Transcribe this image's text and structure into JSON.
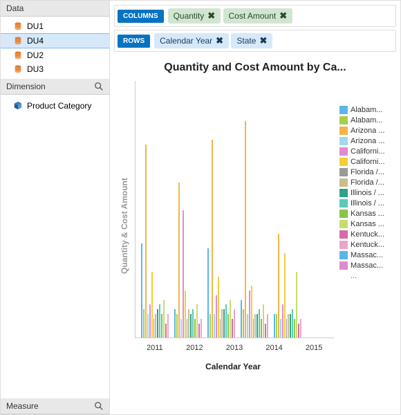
{
  "sidebar": {
    "data_header": "Data",
    "data_items": [
      {
        "label": "DU1",
        "selected": false
      },
      {
        "label": "DU4",
        "selected": true
      },
      {
        "label": "DU2",
        "selected": false
      },
      {
        "label": "DU3",
        "selected": false
      }
    ],
    "dimension_header": "Dimension",
    "dimension_items": [
      {
        "label": "Product Category"
      }
    ],
    "measure_header": "Measure"
  },
  "shelves": {
    "columns_label": "COLUMNS",
    "columns_pills": [
      {
        "label": "Quantity",
        "kind": "measure"
      },
      {
        "label": "Cost Amount",
        "kind": "measure"
      }
    ],
    "rows_label": "ROWS",
    "rows_pills": [
      {
        "label": "Calendar Year",
        "kind": "dim"
      },
      {
        "label": "State",
        "kind": "dim"
      }
    ]
  },
  "chart": {
    "title": "Quantity and Cost Amount by Ca...",
    "xlabel": "Calendar Year",
    "ylabel": "Quantity & Cost Amount",
    "legend_colors": {
      "c0": "#5bb5e8",
      "c1": "#a8cf4c",
      "c2": "#f2b54a",
      "c3": "#a1d7f2",
      "c4": "#e08bd0",
      "c5": "#f2cf3a",
      "c6": "#9a9a9a",
      "c7": "#c9bd8e",
      "c8": "#2fa08a",
      "c9": "#5cc9b8",
      "c10": "#88c44a",
      "c11": "#c5dd6a",
      "c12": "#d86aa8",
      "c13": "#e8a6cc"
    },
    "legend": [
      {
        "label": "Alabam...",
        "color": "c0"
      },
      {
        "label": "Alabam...",
        "color": "c1"
      },
      {
        "label": "Arizona ...",
        "color": "c2"
      },
      {
        "label": "Arizona ...",
        "color": "c3"
      },
      {
        "label": "Californi...",
        "color": "c4"
      },
      {
        "label": "Californi...",
        "color": "c5"
      },
      {
        "label": "Florida /...",
        "color": "c6"
      },
      {
        "label": "Florida /...",
        "color": "c7"
      },
      {
        "label": "Illinois / ...",
        "color": "c8"
      },
      {
        "label": "Illinois / ...",
        "color": "c9"
      },
      {
        "label": "Kansas ...",
        "color": "c10"
      },
      {
        "label": "Kansas ...",
        "color": "c11"
      },
      {
        "label": "Kentuck...",
        "color": "c12"
      },
      {
        "label": "Kentuck...",
        "color": "c13"
      },
      {
        "label": "Massac...",
        "color": "c0"
      },
      {
        "label": "Massac...",
        "color": "c4"
      }
    ],
    "legend_more": "..."
  },
  "chart_data": {
    "type": "bar",
    "title": "Quantity and Cost Amount by Calendar Year and State",
    "xlabel": "Calendar Year",
    "ylabel": "Quantity & Cost Amount",
    "ylim": [
      0,
      100
    ],
    "categories": [
      "2011",
      "2012",
      "2013",
      "2014",
      "2015"
    ],
    "series_per_group": [
      "c0",
      "c1",
      "c2",
      "c3",
      "c4",
      "c5",
      "c6",
      "c7",
      "c8",
      "c9",
      "c10",
      "c11",
      "c12",
      "c13"
    ],
    "groups": [
      {
        "year": "2011",
        "values": [
          40,
          12,
          82,
          10,
          14,
          28,
          8,
          10,
          12,
          14,
          10,
          16,
          6,
          10
        ]
      },
      {
        "year": "2012",
        "values": [
          12,
          10,
          66,
          8,
          54,
          20,
          8,
          12,
          10,
          12,
          8,
          14,
          6,
          8
        ]
      },
      {
        "year": "2013",
        "values": [
          38,
          10,
          84,
          10,
          18,
          26,
          8,
          12,
          12,
          14,
          10,
          16,
          8,
          12
        ]
      },
      {
        "year": "2014",
        "values": [
          16,
          12,
          92,
          10,
          20,
          22,
          8,
          10,
          10,
          12,
          8,
          14,
          6,
          10
        ]
      },
      {
        "year": "2015",
        "values": [
          10,
          10,
          44,
          8,
          14,
          36,
          8,
          10,
          10,
          12,
          8,
          28,
          6,
          8
        ]
      }
    ]
  }
}
